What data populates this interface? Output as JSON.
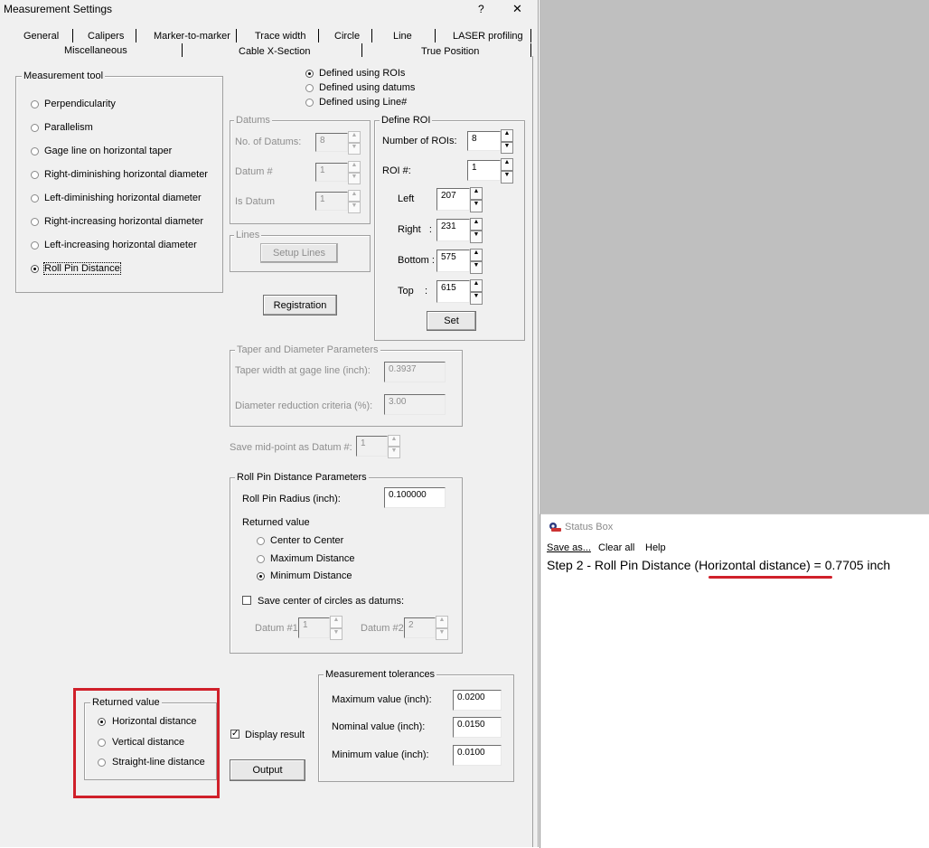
{
  "window": {
    "title": "Measurement Settings",
    "help_glyph": "?",
    "close_glyph": "✕"
  },
  "tabs": {
    "row1": [
      "General",
      "Calipers",
      "Marker-to-marker",
      "Trace width",
      "Circle",
      "Line",
      "LASER profiling"
    ],
    "row2": [
      "Miscellaneous",
      "Cable X-Section",
      "True Position"
    ]
  },
  "tool_group": {
    "legend": "Measurement tool",
    "options": [
      "Perpendicularity",
      "Parallelism",
      "Gage line on horizontal taper",
      "Right-diminishing horizontal diameter",
      "Left-diminishing horizontal diameter",
      "Right-increasing horizontal diameter",
      "Left-increasing horizontal diameter",
      "Roll Pin Distance"
    ],
    "selected": "Roll Pin Distance"
  },
  "definition": {
    "options": [
      "Defined using ROIs",
      "Defined using datums",
      "Defined using Line#"
    ],
    "selected": "Defined using ROIs"
  },
  "datums": {
    "legend": "Datums",
    "no_label": "No. of Datums:",
    "no_value": "8",
    "num_label": "Datum #",
    "num_value": "1",
    "is_label": "Is Datum",
    "is_value": "1"
  },
  "lines": {
    "legend": "Lines",
    "button": "Setup Lines"
  },
  "registration_button": "Registration",
  "roi": {
    "legend": "Define ROI",
    "count_label": "Number of ROIs:",
    "count_value": "8",
    "num_label": "ROI #:",
    "num_value": "1",
    "left_label": "Left",
    "left_value": "207",
    "right_label": "Right   :",
    "right_value": "231",
    "bottom_label": "Bottom :",
    "bottom_value": "575",
    "top_label": "Top    :",
    "top_value": "615",
    "set_button": "Set"
  },
  "taper": {
    "legend": "Taper and Diameter Parameters",
    "width_label": "Taper width at gage line (inch):",
    "width_value": "0.3937",
    "reduction_label": "Diameter reduction criteria (%):",
    "reduction_value": "3.00"
  },
  "midpoint": {
    "label": "Save mid-point as Datum #:",
    "value": "1"
  },
  "rollpin": {
    "legend": "Roll Pin Distance Parameters",
    "radius_label": "Roll Pin Radius (inch):",
    "radius_value": "0.100000",
    "returned_label": "Returned value",
    "options": [
      "Center to Center",
      "Maximum Distance",
      "Minimum Distance"
    ],
    "selected": "Minimum Distance",
    "save_label": "Save center of circles as datums:",
    "save_checked": false,
    "datum1_label": "Datum #1:",
    "datum1_value": "1",
    "datum2_label": "Datum #2:",
    "datum2_value": "2"
  },
  "returned": {
    "legend": "Returned value",
    "options": [
      "Horizontal distance",
      "Vertical distance",
      "Straight-line distance"
    ],
    "selected": "Horizontal distance"
  },
  "display_result": {
    "label": "Display result",
    "checked": true
  },
  "output_button": "Output",
  "tolerances": {
    "legend": "Measurement tolerances",
    "max_label": "Maximum value (inch):",
    "max_value": "0.0200",
    "nom_label": "Nominal value (inch):",
    "nom_value": "0.0150",
    "min_label": "Minimum value (inch):",
    "min_value": "0.0100"
  },
  "status_box": {
    "title": "Status Box",
    "menu": [
      "Save as...",
      "Clear all",
      "Help"
    ],
    "message": "Step 2 - Roll Pin Distance (Horizontal distance) = 0.7705 inch"
  },
  "colors": {
    "highlight": "#d0202a",
    "dialog_bg": "#f0f0f0",
    "desktop_gray": "#bfbfbf"
  }
}
